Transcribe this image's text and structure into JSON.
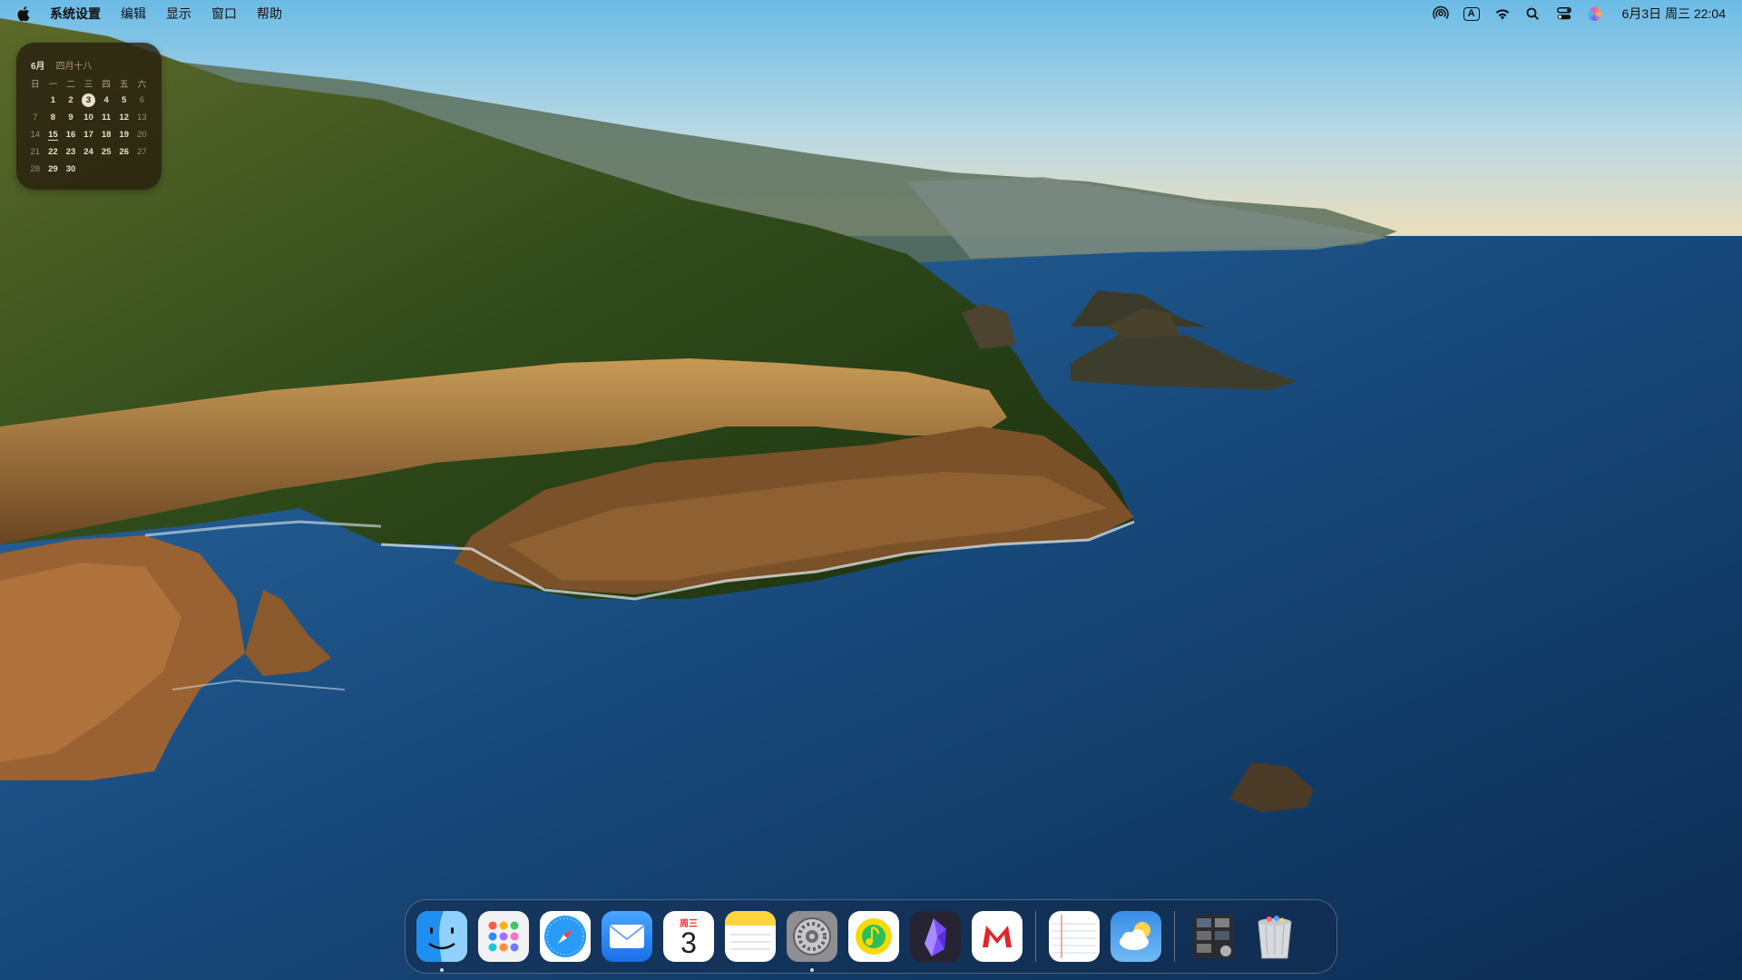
{
  "menubar": {
    "app_name": "系统设置",
    "menus": [
      "编辑",
      "显示",
      "窗口",
      "帮助"
    ],
    "status_icons": [
      "airdrop-icon",
      "input-method-icon",
      "wifi-icon",
      "search-icon",
      "control-center-icon",
      "siri-icon"
    ],
    "input_method_label": "A",
    "clock": "6月3日 周三  22:04"
  },
  "calendar_widget": {
    "month": "6月",
    "lunar": "四月十八",
    "weekdays": [
      "日",
      "一",
      "二",
      "三",
      "四",
      "五",
      "六"
    ],
    "weeks": [
      [
        "",
        "1",
        "2",
        "3",
        "4",
        "5",
        "6"
      ],
      [
        "7",
        "8",
        "9",
        "10",
        "11",
        "12",
        "13"
      ],
      [
        "14",
        "15",
        "16",
        "17",
        "18",
        "19",
        "20"
      ],
      [
        "21",
        "22",
        "23",
        "24",
        "25",
        "26",
        "27"
      ],
      [
        "28",
        "29",
        "30",
        "",
        "",
        "",
        ""
      ]
    ],
    "today": "3",
    "underlined": "15"
  },
  "dock": {
    "apps": [
      {
        "name": "Finder",
        "icon": "finder-icon",
        "running": true
      },
      {
        "name": "Launchpad",
        "icon": "launchpad-icon",
        "running": false
      },
      {
        "name": "Safari",
        "icon": "safari-icon",
        "running": false
      },
      {
        "name": "Mail",
        "icon": "mail-icon",
        "running": false
      },
      {
        "name": "Calendar",
        "icon": "calendar-icon",
        "running": false,
        "weekday": "周三",
        "day": "3"
      },
      {
        "name": "Notes",
        "icon": "notes-icon",
        "running": false
      },
      {
        "name": "System Settings",
        "icon": "settings-icon",
        "running": true
      },
      {
        "name": "QQ Music",
        "icon": "music-icon",
        "running": false
      },
      {
        "name": "Obsidian",
        "icon": "obsidian-icon",
        "running": false
      },
      {
        "name": "Mail Master",
        "icon": "mail-m-icon",
        "running": false
      },
      {
        "name": "Notepad",
        "icon": "notepad-icon",
        "running": false
      },
      {
        "name": "Weather",
        "icon": "weather-icon",
        "running": false
      },
      {
        "name": "Downloads Stack",
        "icon": "stack-icon",
        "running": false
      },
      {
        "name": "Trash",
        "icon": "trash-icon",
        "running": false
      }
    ]
  }
}
